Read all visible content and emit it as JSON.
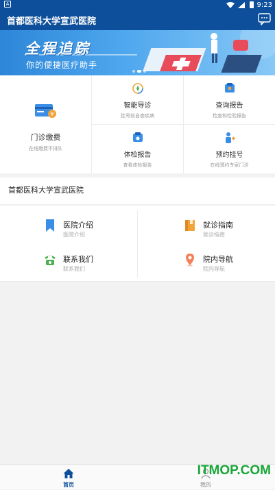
{
  "status_bar": {
    "time": "9:23",
    "notif_glyph": "A"
  },
  "appbar": {
    "title": "首都医科大学宣武医院",
    "message_icon": "chat-bubble-icon"
  },
  "banner": {
    "headline": "全程追踪",
    "subtitle": "你的便捷医疗助手"
  },
  "services": {
    "big": {
      "label": "门诊缴费",
      "desc": "在线缴费不排队",
      "icon": "payment-card-icon"
    },
    "items": [
      {
        "label": "智能导诊",
        "desc": "挂号前自查疾病",
        "icon": "compass-icon"
      },
      {
        "label": "查询报告",
        "desc": "检查和检验报告",
        "icon": "report-icon"
      },
      {
        "label": "体检报告",
        "desc": "查看体检报告",
        "icon": "health-report-icon"
      },
      {
        "label": "预约挂号",
        "desc": "在线预约专家门诊",
        "icon": "doctor-icon"
      }
    ]
  },
  "hospital": {
    "name": "首都医科大学宣武医院"
  },
  "links": [
    {
      "label": "医院介绍",
      "desc": "医院介绍",
      "icon": "bookmark-icon"
    },
    {
      "label": "就诊指南",
      "desc": "就诊指南",
      "icon": "book-icon"
    },
    {
      "label": "联系我们",
      "desc": "联系我们",
      "icon": "phone-icon"
    },
    {
      "label": "院内导航",
      "desc": "院内导航",
      "icon": "location-pin-icon"
    }
  ],
  "tabbar": {
    "home": "首页",
    "mine": "我的"
  },
  "watermark": "ITMOP.COM",
  "colors": {
    "primary": "#0d4f9a",
    "accent_orange": "#f2a33a",
    "accent_green": "#4caf50"
  }
}
